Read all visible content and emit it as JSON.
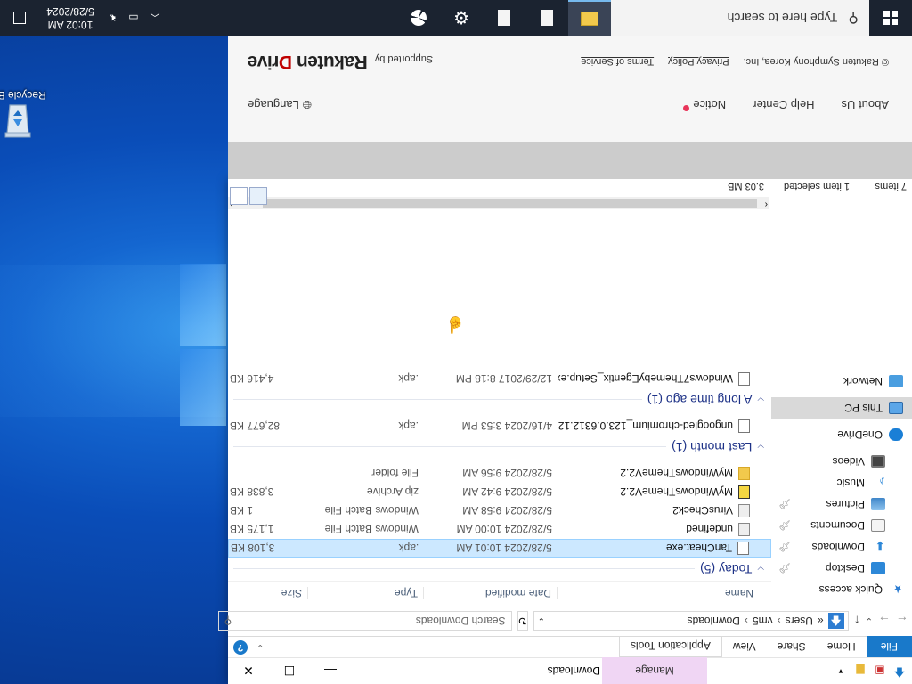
{
  "explorer": {
    "title": "Downloads",
    "manage_tab": "Manage",
    "ribbon_tabs": [
      "File",
      "Home",
      "Share",
      "View",
      "Application Tools"
    ],
    "help_label": "?",
    "address": {
      "parts": [
        "Users",
        "vm5",
        "Downloads"
      ],
      "overflow": "«"
    },
    "search_placeholder": "Search Downloads",
    "columns": {
      "name": "Name",
      "date": "Date modified",
      "type": "Type",
      "size": "Size"
    },
    "nav": [
      {
        "label": "Quick access",
        "icon": "star-icon",
        "child": false,
        "pinned": false
      },
      {
        "label": "Desktop",
        "icon": "desktop-folder-icon",
        "child": true,
        "pinned": true
      },
      {
        "label": "Downloads",
        "icon": "download-arrow-icon",
        "child": true,
        "pinned": true
      },
      {
        "label": "Documents",
        "icon": "documents-icon",
        "child": true,
        "pinned": true
      },
      {
        "label": "Pictures",
        "icon": "pictures-icon",
        "child": true,
        "pinned": true
      },
      {
        "label": "Music",
        "icon": "music-icon",
        "child": true,
        "pinned": false
      },
      {
        "label": "Videos",
        "icon": "videos-icon",
        "child": true,
        "pinned": false
      },
      {
        "label": "OneDrive",
        "icon": "onedrive-cloud-icon",
        "child": false,
        "pinned": false
      },
      {
        "label": "This PC",
        "icon": "this-pc-icon",
        "child": false,
        "pinned": false
      },
      {
        "label": "Network",
        "icon": "network-icon",
        "child": false,
        "pinned": false
      }
    ],
    "groups": [
      {
        "label": "Today (5)",
        "files": [
          {
            "name": "TanCheat.exe",
            "date": "5/28/2024 10:01 AM",
            "type": ".apk",
            "size": "3,108 KB",
            "icon": "blank-file-icon",
            "selected": true
          },
          {
            "name": "undefined",
            "date": "5/28/2024 10:00 AM",
            "type": "Windows Batch File",
            "size": "1,175 KB",
            "icon": "batch-file-icon",
            "selected": false
          },
          {
            "name": "VirusCheck2",
            "date": "5/28/2024 9:58 AM",
            "type": "Windows Batch File",
            "size": "1 KB",
            "icon": "batch-file-icon",
            "selected": false
          },
          {
            "name": "MyWindowsThemeV2.2",
            "date": "5/28/2024 9:42 AM",
            "type": "zip Archive",
            "size": "3,838 KB",
            "icon": "zip-archive-icon",
            "selected": false
          },
          {
            "name": "MyWindowsThemeV2.2",
            "date": "5/28/2024 9:56 AM",
            "type": "File folder",
            "size": "",
            "icon": "folder-icon",
            "selected": false
          }
        ]
      },
      {
        "label": "Last month (1)",
        "files": [
          {
            "name": "ungoogled-chromium_123.0.6312.122-1....",
            "date": "4/16/2024 3:53 PM",
            "type": ".apk",
            "size": "82,677 KB",
            "icon": "blank-file-icon",
            "selected": false
          }
        ]
      },
      {
        "label": "A long time ago (1)",
        "files": [
          {
            "name": "Windows7ThemebyEgentix_Setup.exe",
            "date": "12/29/2017 8:18 PM",
            "type": ".apk",
            "size": "4,416 KB",
            "icon": "blank-file-icon",
            "selected": false
          }
        ]
      }
    ],
    "status": {
      "items": "7 items",
      "selected": "1 item selected",
      "size": "3.03 MB"
    }
  },
  "webpage": {
    "links": [
      "About Us",
      "Help Center",
      "Notice"
    ],
    "language": "Language",
    "copyright": "© Rakuten Symphony Korea, Inc.",
    "privacy": "Privacy Policy",
    "terms": "Terms of Service",
    "supported_by": "Supported by",
    "brand_a": "Rakuten ",
    "brand_d": "D",
    "brand_b": "rive"
  },
  "desktop": {
    "recycle_bin": "Recycle Bin"
  },
  "taskbar": {
    "search_placeholder": "Type here to search",
    "time": "10:02 AM",
    "date": "5/28/2024"
  },
  "colors": {
    "accent": "#1979ca",
    "selection": "#cce8ff",
    "taskbar": "#1b2330",
    "rakuten_red": "#bf0000"
  }
}
